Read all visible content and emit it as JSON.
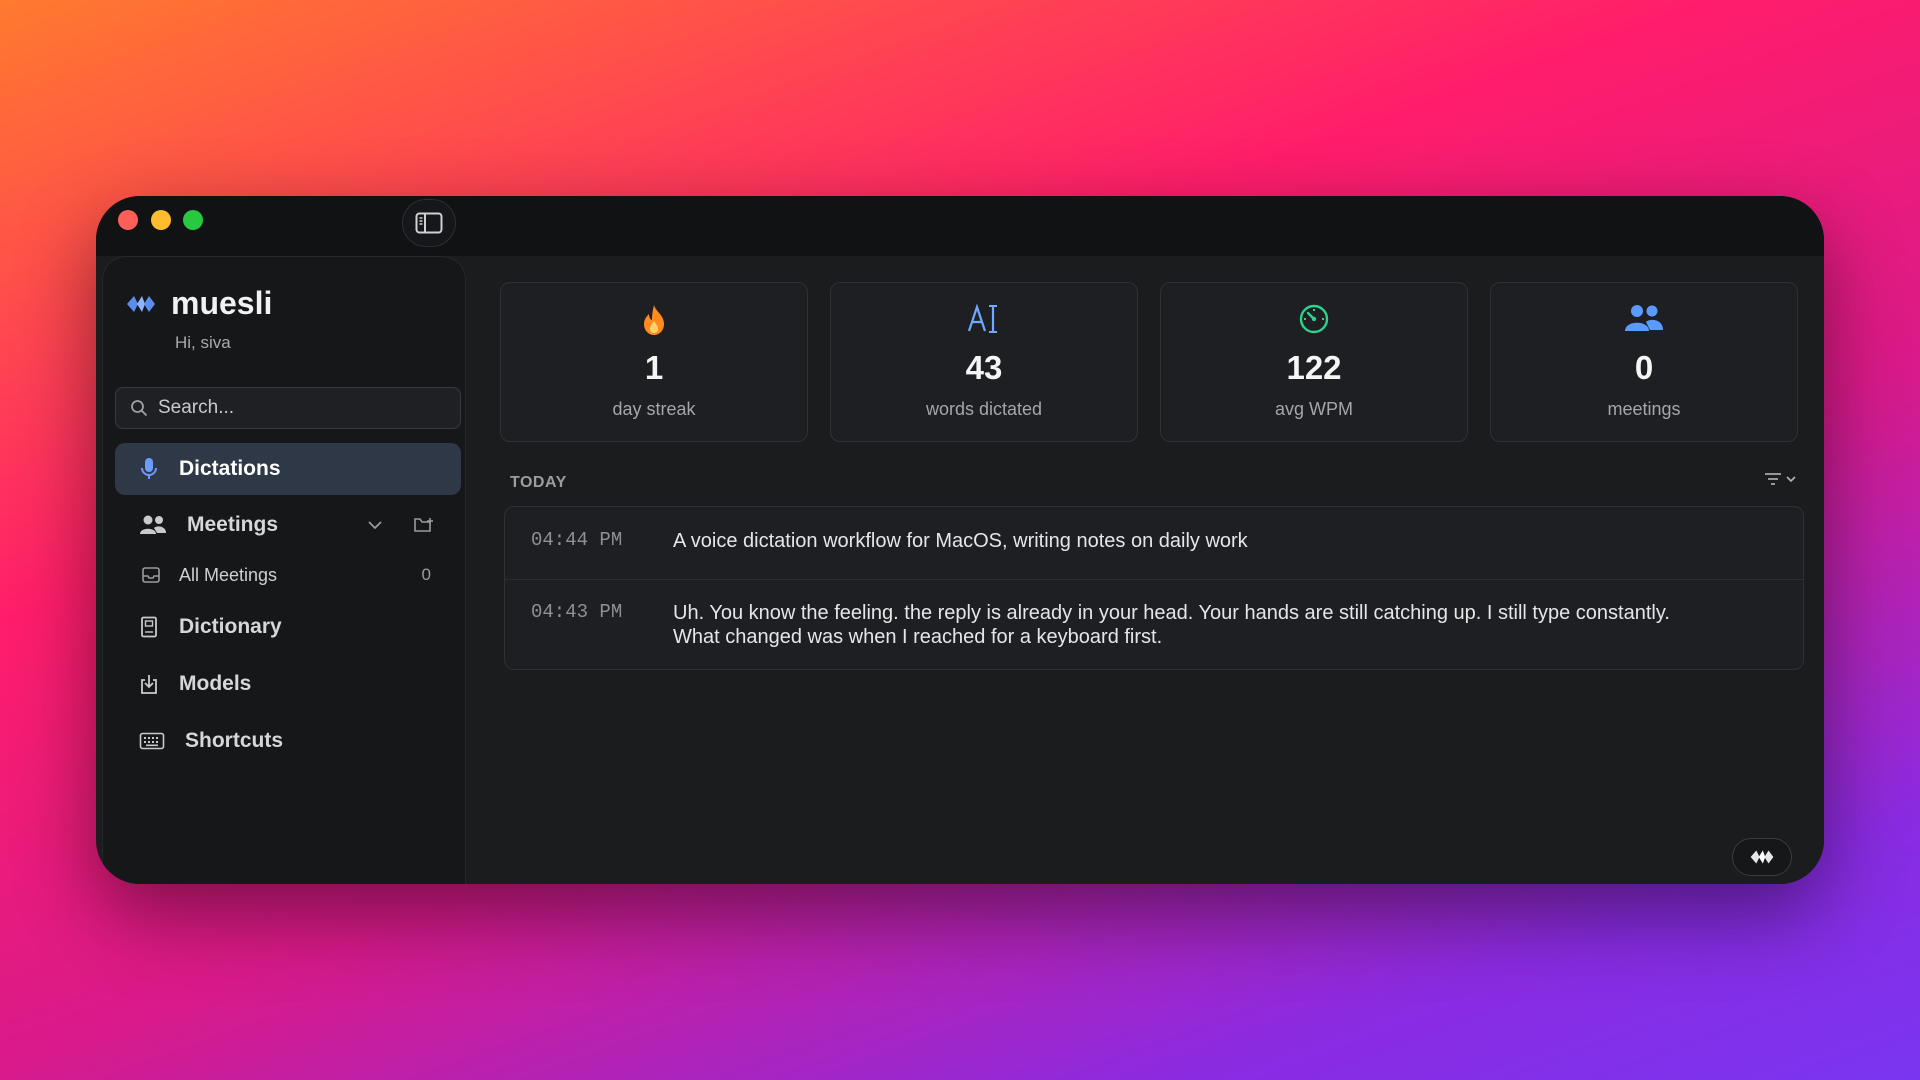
{
  "app": {
    "name": "muesli",
    "greeting": "Hi, siva"
  },
  "search": {
    "placeholder": "Search...",
    "value": ""
  },
  "sidebar": {
    "items": [
      {
        "label": "Dictations",
        "icon": "mic-icon",
        "active": true
      },
      {
        "label": "Meetings",
        "icon": "people-icon"
      },
      {
        "label": "All Meetings",
        "icon": "inbox-icon",
        "count": "0"
      },
      {
        "label": "Dictionary",
        "icon": "book-icon"
      },
      {
        "label": "Models",
        "icon": "download-icon"
      },
      {
        "label": "Shortcuts",
        "icon": "keyboard-icon"
      }
    ]
  },
  "stats": [
    {
      "value": "1",
      "caption": "day streak",
      "icon": "flame-icon",
      "color": "#ff8a1f"
    },
    {
      "value": "43",
      "caption": "words dictated",
      "icon": "text-cursor-icon",
      "color": "#6fa8ff"
    },
    {
      "value": "122",
      "caption": "avg WPM",
      "icon": "speedometer-icon",
      "color": "#2fd28a"
    },
    {
      "value": "0",
      "caption": "meetings",
      "icon": "people-icon",
      "color": "#5b9bff"
    }
  ],
  "section": {
    "label": "TODAY"
  },
  "dictations": [
    {
      "time": "04:44 PM",
      "text": "A voice dictation workflow for MacOS, writing notes on daily work"
    },
    {
      "time": "04:43 PM",
      "text": "Uh. You know the feeling. the reply is already in your head. Your hands are still catching up. I still type constantly. What changed was when I reached for a keyboard first."
    }
  ],
  "colors": {
    "accent": "#5b8def",
    "active_bg": "#2f3847"
  }
}
